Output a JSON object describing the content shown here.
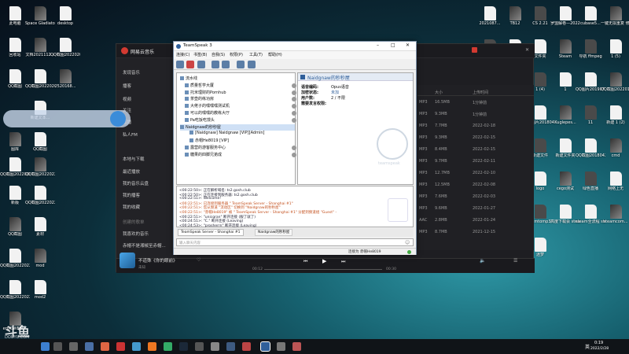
{
  "desktop": {
    "left_icons": [
      "此电脑",
      "Space Gladiators",
      "desktop",
      "回收站",
      "文档2021112...",
      "QQ截图20220202...",
      "QQ截图2022020...",
      "2520168...",
      "QQ截图",
      "新建文本...",
      "图库",
      "QQ截图",
      "QQ截图2022020...",
      "QQ截图20220224...",
      "新版",
      "QQ截图20220224...",
      "QQ截图",
      "素材",
      "QQ截图20220224...",
      "mod",
      "QQ截图20220224...",
      "mod2",
      "erGOWEBI..."
    ],
    "right_icons": [
      "2021087...",
      "TB12",
      "CS 2.21",
      "罗盟解卷—2022",
      "cubase5...",
      "一键无损重复 修仙体 mp4",
      "文件夹",
      "未命名",
      "文件夹",
      "Steam",
      "导航 ffmpeg",
      "1 (5)",
      "1 (3)",
      "1 (2)",
      "1 (4)",
      "1",
      "QQ图片20190730...",
      "QQ截图20220111...",
      "1 (4)",
      "1 (5)",
      "QQ图片20180422...",
      "Kuglepes...",
      "11",
      "新建 1 (2)",
      "QQ截图20180421...",
      "过帮",
      "新建文件",
      "新建文件夹",
      "QQ截图20180422...",
      "cmd",
      "新建文本文档",
      "QQ截图",
      "logo",
      "cego测试",
      "绿色直播",
      "网络上无",
      "录制配置",
      "ASF win-x64",
      "ncmtomp3",
      "高度下载会 steam下载",
      "steam全流程 steam游戏",
      "steamcom...",
      "lim2Srv.1.2",
      "cpu-z_1.88...",
      "迷梦"
    ],
    "watermark_brand": "斗鱼",
    "watermark_sub": "DOUYU.COM"
  },
  "netease": {
    "title": "网易云音乐",
    "sidebar": [
      "发现音乐",
      "播客",
      "视频",
      "关注",
      "直播",
      "私人FM",
      "本地与下载",
      "最近播放",
      "我的音乐云盘",
      "我的播客",
      "我的收藏",
      "创建的歌单",
      "我喜欢的音乐",
      "赤帽不是湘椒至赤帽..."
    ],
    "columns": {
      "quality": "MP3",
      "size": "大小",
      "time": "上传时间"
    },
    "rows": [
      {
        "fmt": "MP3",
        "size": "16.5MB",
        "date": "1分钟前"
      },
      {
        "fmt": "MP3",
        "size": "9.3MB",
        "date": "1分钟前"
      },
      {
        "fmt": "MP3",
        "size": "7.7MB",
        "date": "2022-02-18"
      },
      {
        "fmt": "MP3",
        "size": "9.3MB",
        "date": "2022-02-15"
      },
      {
        "fmt": "MP3",
        "size": "8.4MB",
        "date": "2022-02-15"
      },
      {
        "fmt": "MP3",
        "size": "9.7MB",
        "date": "2022-02-11"
      },
      {
        "fmt": "MP3",
        "size": "12.7MB",
        "date": "2022-02-10"
      },
      {
        "fmt": "MP3",
        "size": "12.5MB",
        "date": "2022-02-08"
      },
      {
        "fmt": "MP3",
        "size": "7.6MB",
        "date": "2022-02-03"
      },
      {
        "fmt": "MP3",
        "size": "9.6MB",
        "date": "2022-01-27"
      },
      {
        "fmt": "AAC",
        "size": "2.8MB",
        "date": "2022-01-24"
      },
      {
        "fmt": "MP3",
        "size": "8.7MB",
        "date": "2021-12-15"
      }
    ],
    "player": {
      "song": "不道殊《你的眼前》",
      "artist": "未知",
      "time_elapsed": "00:12",
      "time_total": "00:30"
    }
  },
  "teamspeak": {
    "title": "TeamSpeak 3",
    "menu": [
      "连接(C)",
      "书签(B)",
      "自我(S)",
      "权限(P)",
      "工具(T)",
      "帮助(H)"
    ],
    "tree": [
      {
        "name": "流水线",
        "indent": 0
      },
      {
        "name": "质量哲学大厦",
        "indent": 1
      },
      {
        "name": "托米理财的Pornhub",
        "indent": 1
      },
      {
        "name": "茶壶的练功房",
        "indent": 1
      },
      {
        "name": "大佬子的嘿嘿嘿测试机",
        "indent": 1
      },
      {
        "name": "可以的嘿嘿的教练大厅",
        "indent": 1
      },
      {
        "name": "Pa吃饭吃馒头",
        "indent": 1
      },
      {
        "name": "Naidgnaw的秒秒屋",
        "indent": 0
      },
      {
        "name": "[Naidgnaw] Naidgnaw [VIP][Admin]",
        "indent": 2
      },
      {
        "name": "赤帽He8019 [VIP]",
        "indent": 2
      },
      {
        "name": "露营的游客服务中心",
        "indent": 1
      },
      {
        "name": "糖果的四脚兄弟成",
        "indent": 1
      }
    ],
    "info": {
      "channel_name": "Naidgnaw的秒秒屋",
      "fields": [
        {
          "label": "语音编码:",
          "value": "Opus语音"
        },
        {
          "label": "加密状态:",
          "value": "未加"
        },
        {
          "label": "用户数:",
          "value": "2 / 不限"
        },
        {
          "label": "需要发言权限:",
          "value": ""
        }
      ],
      "logo_text": "teamspeak"
    },
    "log": [
      "<00:22:50>: 正在解析域名: ts2.gosh.club",
      "<00:22:50>: 正在连接到服务器: ts2.gosh.club",
      "<00:22:51>: Welcome!",
      "<00:22:51>: 已连接到服务器 \" TeamSpeak Server - Shanghai #1\"",
      "<00:22:51>: 您从频道 \"流动区\" 切换到 \"Naidgnaw的秒秒屋\"",
      "<00:22:51>: \"赤帽He8019\" 被 \" TeamSpeak Server - Shanghai #1\" 分配到频道组 \"Guest\" -",
      "<00:22:51>: \"unicgran\" 断开连接 (服了就了)",
      "<00:24:51>: \"C.\" 断开连接 (Leaving)",
      "<00:24:53>: \"prosherrn\" 断开连接 (Leaving)"
    ],
    "tabs": [
      "TeamSpeak Server - Shanghai #1",
      "Naidgnaw的秒秒屋"
    ],
    "input_placeholder": "输入聊天内容",
    "status": "连接为 赤帽He8019"
  },
  "taskbar": {
    "clock": "0:19",
    "date": "2022/2/28",
    "lang": "英"
  },
  "colors": {
    "ts_accent": "#2f5f9a",
    "netease_red": "#d33a31",
    "log_orange": "#c4501d"
  }
}
